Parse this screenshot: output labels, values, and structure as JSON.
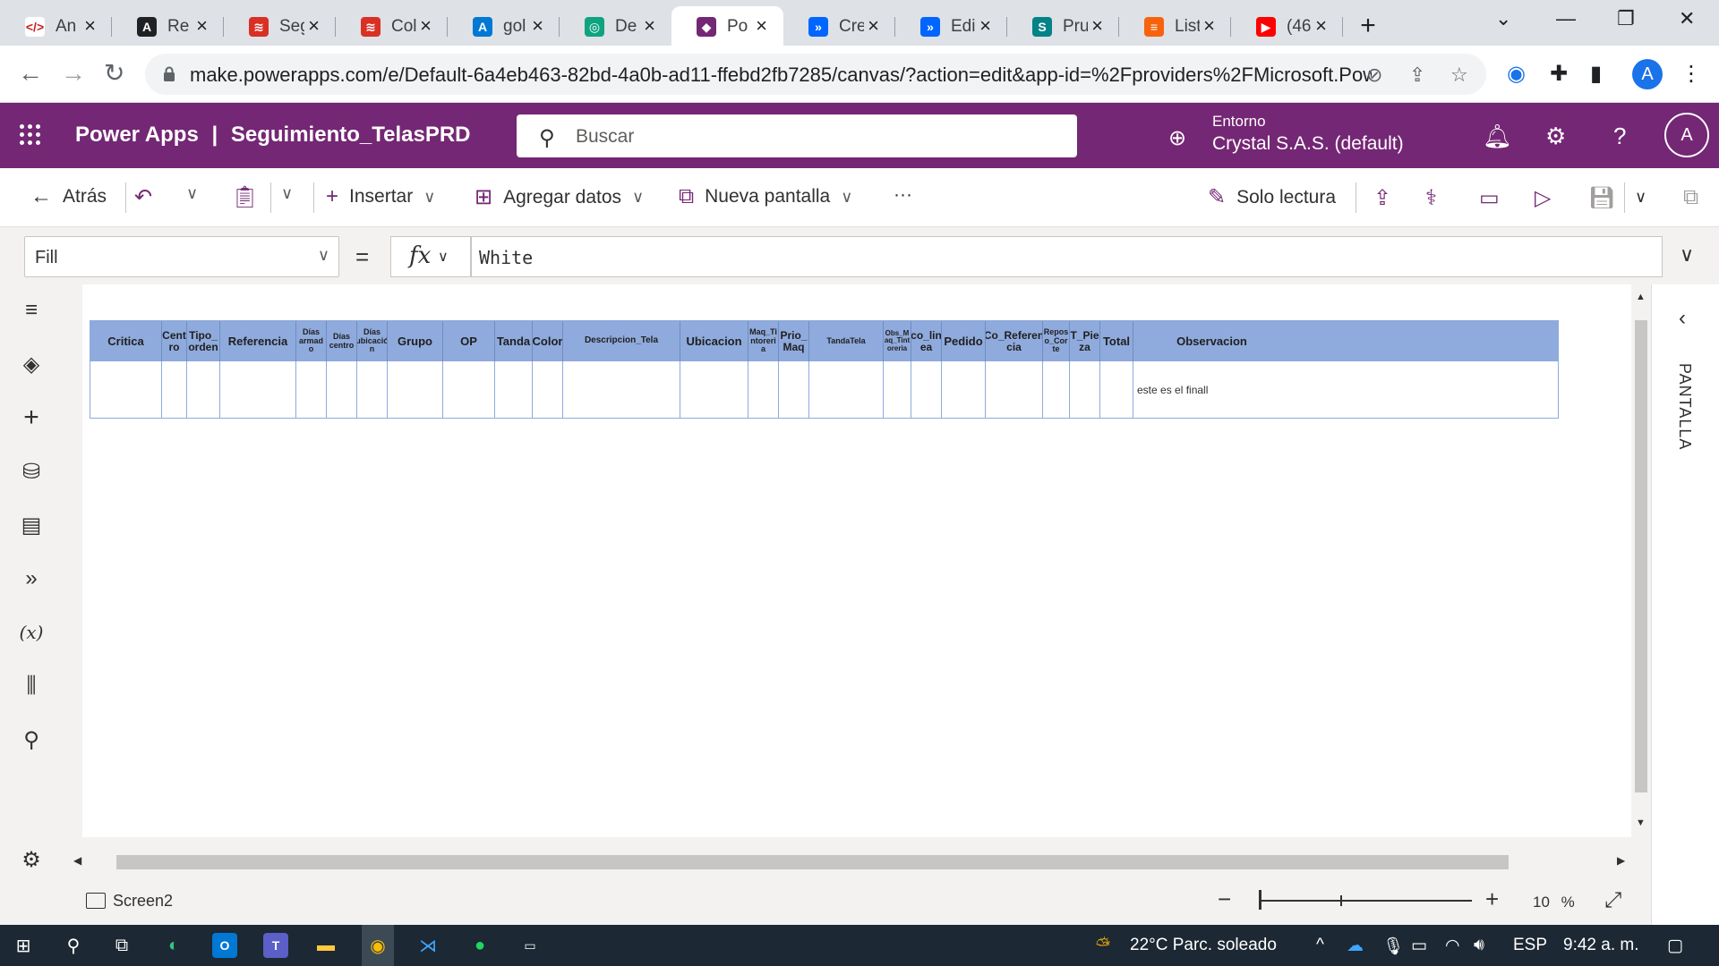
{
  "browser": {
    "tabs": [
      {
        "label": "An",
        "icon": "code-icon",
        "color": "#ffffff",
        "fg": "#c5221f",
        "glyph": "</>"
      },
      {
        "label": "Re",
        "icon": "angular-icon",
        "color": "#202124",
        "fg": "#ffffff",
        "glyph": "A"
      },
      {
        "label": "Seg",
        "icon": "layers-icon",
        "color": "#d93025",
        "fg": "#ffffff",
        "glyph": "≋"
      },
      {
        "label": "Col",
        "icon": "layers-icon",
        "color": "#d93025",
        "fg": "#ffffff",
        "glyph": "≋"
      },
      {
        "label": "gol",
        "icon": "azure-icon",
        "color": "#0078d4",
        "fg": "#ffffff",
        "glyph": "A"
      },
      {
        "label": "De",
        "icon": "openai-icon",
        "color": "#10a37f",
        "fg": "#ffffff",
        "glyph": "◎"
      },
      {
        "label": "Po",
        "icon": "powerapps-icon",
        "color": "#742774",
        "fg": "#ffffff",
        "glyph": "◆"
      },
      {
        "label": "Cre",
        "icon": "powerautomate-icon",
        "color": "#0066ff",
        "fg": "#ffffff",
        "glyph": "»"
      },
      {
        "label": "Edi",
        "icon": "powerautomate-icon",
        "color": "#0066ff",
        "fg": "#ffffff",
        "glyph": "»"
      },
      {
        "label": "Pru",
        "icon": "sharepoint-icon",
        "color": "#038387",
        "fg": "#ffffff",
        "glyph": "S"
      },
      {
        "label": "List",
        "icon": "lists-icon",
        "color": "#f7630c",
        "fg": "#ffffff",
        "glyph": "≡"
      },
      {
        "label": "(46",
        "icon": "youtube-icon",
        "color": "#ff0000",
        "fg": "#ffffff",
        "glyph": "▶"
      }
    ],
    "active_tab": 6,
    "url": "make.powerapps.com/e/Default-6a4eb463-82bd-4a0b-ad11-ffebd2fb7285/canvas/?action=edit&app-id=%2Fproviders%2FMicrosoft.Pow...",
    "profile_initial": "A"
  },
  "header": {
    "app_name": "Power Apps",
    "separator": "|",
    "project": "Seguimiento_TelasPRD",
    "search_placeholder": "Buscar",
    "env_label": "Entorno",
    "env_name": "Crystal S.A.S. (default)",
    "user_initial": "A"
  },
  "commandbar": {
    "back": "Atrás",
    "insert": "Insertar",
    "add_data": "Agregar datos",
    "new_screen": "Nueva pantalla",
    "more": "···",
    "read_only": "Solo lectura"
  },
  "formula": {
    "property": "Fill",
    "equals": "=",
    "fx": "fx",
    "value": "White"
  },
  "table": {
    "header_bg": "#8faadc",
    "columns": [
      {
        "label": "Critica",
        "w": 80,
        "fs": 13
      },
      {
        "label": "Cent ro",
        "w": 28,
        "fs": 12
      },
      {
        "label": "Tipo_ orden",
        "w": 37,
        "fs": 12
      },
      {
        "label": "Referencia",
        "w": 85,
        "fs": 13
      },
      {
        "label": "Días armad o",
        "w": 34,
        "fs": 9
      },
      {
        "label": "Días centro",
        "w": 34,
        "fs": 9
      },
      {
        "label": "Días ubicació n",
        "w": 34,
        "fs": 9
      },
      {
        "label": "Grupo",
        "w": 62,
        "fs": 13
      },
      {
        "label": "OP",
        "w": 58,
        "fs": 13
      },
      {
        "label": "Tanda",
        "w": 42,
        "fs": 13
      },
      {
        "label": "Color",
        "w": 34,
        "fs": 13
      },
      {
        "label": "Descripcion_Tela",
        "w": 131,
        "fs": 10
      },
      {
        "label": "Ubicacion",
        "w": 76,
        "fs": 13
      },
      {
        "label": "Maq_Ti ntoreri a",
        "w": 34,
        "fs": 9
      },
      {
        "label": "Prio_ Maq",
        "w": 34,
        "fs": 12
      },
      {
        "label": "TandaTela",
        "w": 83,
        "fs": 9
      },
      {
        "label": "Obs_M aq_Tint oreria",
        "w": 31,
        "fs": 8
      },
      {
        "label": "co_lin ea",
        "w": 34,
        "fs": 12
      },
      {
        "label": "Pedido",
        "w": 49,
        "fs": 13
      },
      {
        "label": "Co_Referen cia",
        "w": 64,
        "fs": 12
      },
      {
        "label": "Repos o_Cor te",
        "w": 30,
        "fs": 9
      },
      {
        "label": "T_Pie za",
        "w": 34,
        "fs": 12
      },
      {
        "label": "Total",
        "w": 37,
        "fs": 13
      },
      {
        "label": "Observacion",
        "w": 175,
        "fs": 13
      }
    ],
    "row": [
      "",
      "",
      "",
      "",
      "",
      "",
      "",
      "",
      "",
      "",
      "",
      "",
      "",
      "",
      "",
      "",
      "",
      "",
      "",
      "",
      "",
      "",
      "",
      "este es el finall"
    ]
  },
  "rightpanel": {
    "label": "PANTALLA"
  },
  "statusbar": {
    "screen": "Screen2",
    "zoom": "10",
    "zoom_unit": "%"
  },
  "taskbar": {
    "weather": "22°C  Parc. soleado",
    "lang": "ESP",
    "time": "9:42 a. m."
  }
}
